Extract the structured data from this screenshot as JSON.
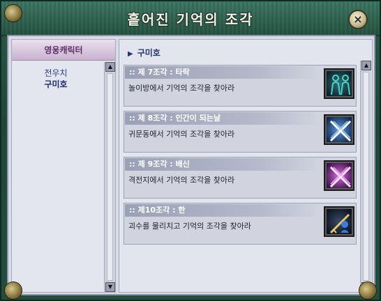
{
  "window": {
    "title": "흩어진 기억의 조각",
    "close_label": "×"
  },
  "left": {
    "header": "영웅캐릭터",
    "items": [
      {
        "label": "전우치",
        "active": false
      },
      {
        "label": "구미호",
        "active": true
      }
    ]
  },
  "right": {
    "breadcrumb": "구미호",
    "quests": [
      {
        "title": ":: 제 7조각 : 타락",
        "desc": "놀이방에서 기억의 조각을 찾아라",
        "icon": "figures-icon"
      },
      {
        "title": ":: 제 8조각 : 인간이 되는날",
        "desc": "귀문동에서 기억의 조각을 찾아라",
        "icon": "crossed-swords-icon"
      },
      {
        "title": ":: 제 9조각 : 배신",
        "desc": "격전지에서 기억의 조각을 찾아라",
        "icon": "crossed-swords-purple-icon"
      },
      {
        "title": ":: 제10조각 : 한",
        "desc": "괴수를 물리치고 기억의 조각을 찾아라",
        "icon": "warrior-icon"
      }
    ]
  },
  "colors": {
    "frame_green": "#24503f",
    "panel_bg": "#e2e4ee",
    "quest_header": "#9aa0b5",
    "breadcrumb_text": "#27356f"
  }
}
